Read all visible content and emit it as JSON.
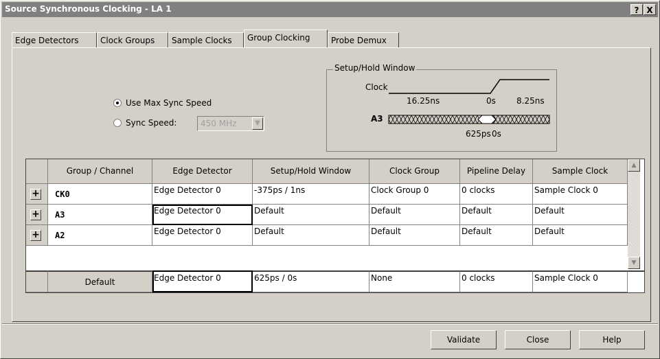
{
  "window": {
    "title": "Source Synchronous Clocking - LA 1",
    "help_btn": "?",
    "close_btn": "X"
  },
  "tabs": [
    {
      "label": "Edge Detectors"
    },
    {
      "label": "Clock Groups"
    },
    {
      "label": "Sample Clocks"
    },
    {
      "label": "Group Clocking",
      "active": true
    },
    {
      "label": "Probe Demux"
    }
  ],
  "sync": {
    "use_max": "Use Max Sync Speed",
    "sync_speed": "Sync Speed:",
    "speed_value": "450 MHz",
    "selected": "use_max"
  },
  "window_diagram": {
    "legend": "Setup/Hold Window",
    "clock_label": "Clock",
    "t_left": "16.25ns",
    "t_zero": "0s",
    "t_right": "8.25ns",
    "signal_label": "A3",
    "window_setup": "625ps",
    "window_hold": "0s"
  },
  "grid": {
    "columns": [
      "Group / Channel",
      "Edge Detector",
      "Setup/Hold Window",
      "Clock Group",
      "Pipeline Delay",
      "Sample Clock"
    ],
    "rows": [
      {
        "expander": "+",
        "name": "CK0",
        "cells": [
          "Edge Detector 0",
          "-375ps / 1ns",
          "Clock Group 0",
          "0 clocks",
          "Sample Clock 0"
        ]
      },
      {
        "expander": "+",
        "name": "A3",
        "cells": [
          "Edge Detector 0",
          "Default",
          "Default",
          "Default",
          "Default"
        ]
      },
      {
        "expander": "+",
        "name": "A2",
        "cells": [
          "Edge Detector 0",
          "Default",
          "Default",
          "Default",
          "Default"
        ]
      }
    ],
    "default_row": {
      "name": "Default",
      "cells": [
        "Edge Detector 0",
        "625ps / 0s",
        "None",
        "0 clocks",
        "Sample Clock 0"
      ]
    }
  },
  "buttons": {
    "validate": "Validate",
    "close": "Close",
    "help": "Help"
  }
}
